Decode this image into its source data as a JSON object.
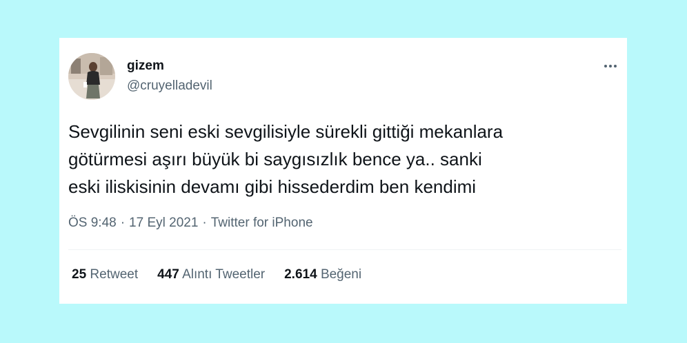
{
  "tweet": {
    "author": {
      "display_name": "gizem",
      "handle": "@cruyelladevil",
      "avatar_icon": "profile-photo"
    },
    "more_icon": "more-horizontal-icon",
    "text_lines": [
      "Sevgilinin seni eski sevgilisiyle sürekli gittiği mekanlara",
      "götürmesi aşırı büyük bi saygısızlık bence ya.. sanki",
      "eski iliskisinin devamı gibi hissederdim ben kendimi"
    ],
    "meta": {
      "time": "ÖS 9:48",
      "separator": "·",
      "date": "17 Eyl 2021",
      "source": "Twitter for iPhone"
    },
    "stats": {
      "retweets": {
        "count": "25",
        "label": "Retweet"
      },
      "quotes": {
        "count": "447",
        "label": "Alıntı Tweetler"
      },
      "likes": {
        "count": "2.614",
        "label": "Beğeni"
      }
    }
  },
  "colors": {
    "page_background": "#b9f9fb",
    "card_background": "#ffffff",
    "primary_text": "#0f1419",
    "secondary_text": "#536471",
    "divider": "#eff3f4"
  }
}
